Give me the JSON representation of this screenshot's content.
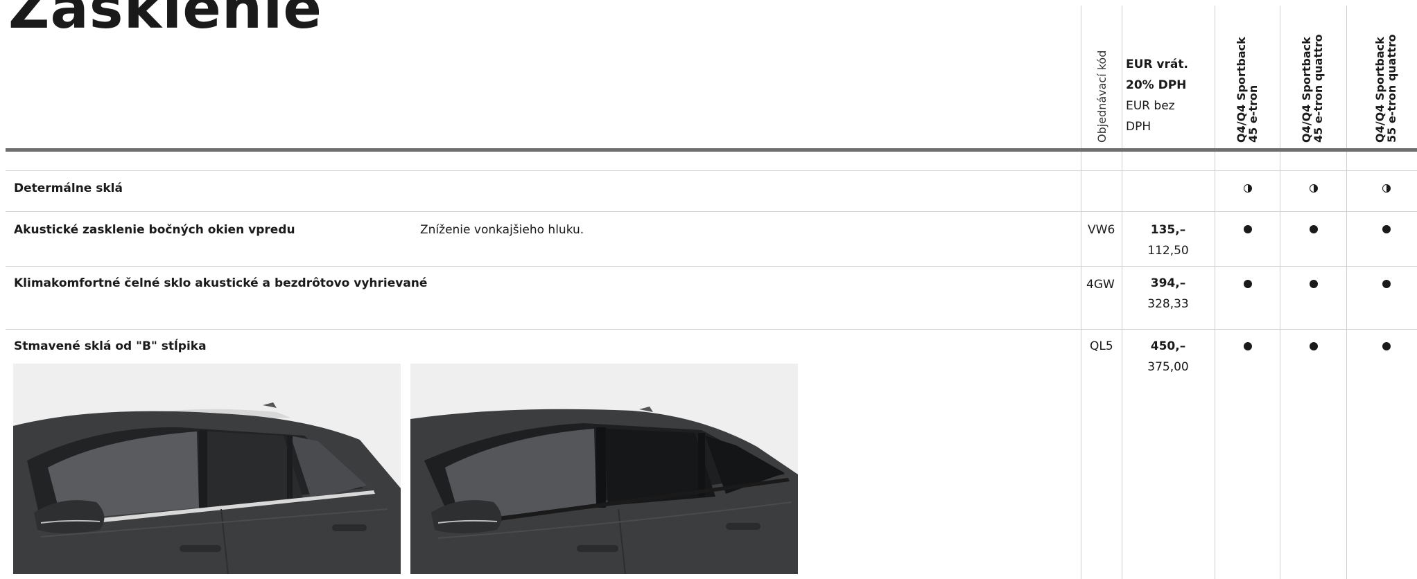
{
  "page": {
    "title": "Zasklenie"
  },
  "header": {
    "code_label": "Objednávací kód",
    "price_incl_l1": "EUR vrát.",
    "price_incl_l2": "20% DPH",
    "price_excl_l1": "EUR bez",
    "price_excl_l2": "DPH",
    "models": [
      {
        "l1": "Q4/Q4 Sportback",
        "l2": "45 e-tron"
      },
      {
        "l1": "Q4/Q4 Sportback",
        "l2": "45 e-tron quattro"
      },
      {
        "l1": "Q4/Q4 Sportback",
        "l2": "55 e-tron quattro"
      }
    ]
  },
  "rows": [
    {
      "title": "Determálne sklá",
      "desc": "",
      "code": "",
      "price_incl": "",
      "price_excl": "",
      "availability": [
        "optional",
        "optional",
        "optional"
      ]
    },
    {
      "title": "Akustické zasklenie bočných okien vpredu",
      "desc": "Zníženie vonkajšieho hluku.",
      "code": "VW6",
      "price_incl": "135,–",
      "price_excl": "112,50",
      "availability": [
        "standard",
        "standard",
        "standard"
      ]
    },
    {
      "title": "Klimakomfortné čelné sklo akustické a bezdrôtovo vyhrievané",
      "desc": "",
      "code": "4GW",
      "price_incl": "394,–",
      "price_excl": "328,33",
      "availability": [
        "standard",
        "standard",
        "standard"
      ]
    },
    {
      "title": "Stmavené sklá od \"B\" stĺpika",
      "desc": "",
      "code": "QL5",
      "price_incl": "450,–",
      "price_excl": "375,00",
      "availability": [
        "standard",
        "standard",
        "standard"
      ]
    }
  ],
  "images": [
    {
      "name": "car-side-clear-glass-photo"
    },
    {
      "name": "car-side-tinted-glass-photo"
    }
  ],
  "colors": {
    "text": "#1a1a1a",
    "rule": "#cfcfcf",
    "thick_rule": "#6e6e6e",
    "car_body": "#3c3d3f"
  }
}
